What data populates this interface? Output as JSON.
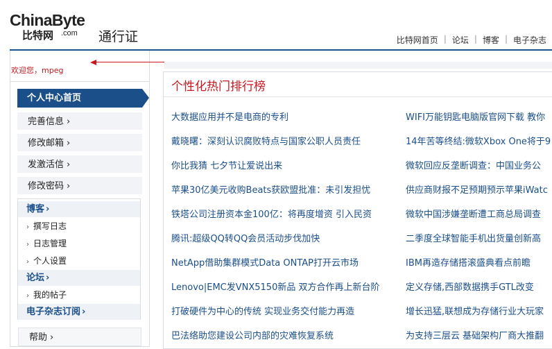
{
  "header": {
    "brand_en": "ChinaByte",
    "brand_cn": "比特网",
    "brand_suffix": ".com",
    "service_name": "通行证",
    "nav": [
      "比特网首页",
      "论坛",
      "博客",
      "电子杂志"
    ]
  },
  "welcome": "欢迎您，mpeg",
  "sidebar": {
    "active": "个人中心首页",
    "items": [
      "完善信息",
      "修改邮箱",
      "发激活信",
      "修改密码"
    ],
    "groups": [
      {
        "title": "博客",
        "items": [
          "撰写日志",
          "日志管理",
          "个人设置"
        ]
      },
      {
        "title": "论坛",
        "items": [
          "我的帖子"
        ]
      },
      {
        "title": "电子杂志订阅",
        "items": []
      }
    ],
    "help": "帮助"
  },
  "main": {
    "title": "个性化热门排行榜",
    "left_news": [
      "大数据应用并不是电商的专利",
      "戴晓曙：深刻认识腐败特点与国家公职人员责任",
      "你比我猜 七夕节让爱说出来",
      "苹果30亿美元收购Beats获欧盟批准：未引发担忧",
      "铁塔公司注册资本金100亿：将再度增资 引入民资",
      "腾讯:超级QQ转QQ会员活动步伐加快",
      "NetApp借助集群模式Data ONTAP打开云市场",
      "Lenovo|EMC发VNX5150新品 双方合作再上新台阶",
      "打破硬件为中心的传统 实现业务交付能力再造",
      "巴法络助您建设公司内部的灾难恢复系统"
    ],
    "right_news": [
      "WIFI万能钥匙电脑版官网下载 教你",
      "14年苦等终结:微软Xbox One将于9",
      "微软回应反垄断调查：中国业务公",
      "供应商财报不足预期预示苹果iWatc",
      "微软中国涉嫌垄断遭工商总局调查",
      "二季度全球智能手机出货量创新高",
      "IBM再造存储搭滚盛典看点前瞻",
      "定义存储,西部数据携手GTL改变",
      "增长迅猛,联想成为存储行业大玩家",
      "为支持三层云 基础架构厂商大推翻"
    ]
  }
}
